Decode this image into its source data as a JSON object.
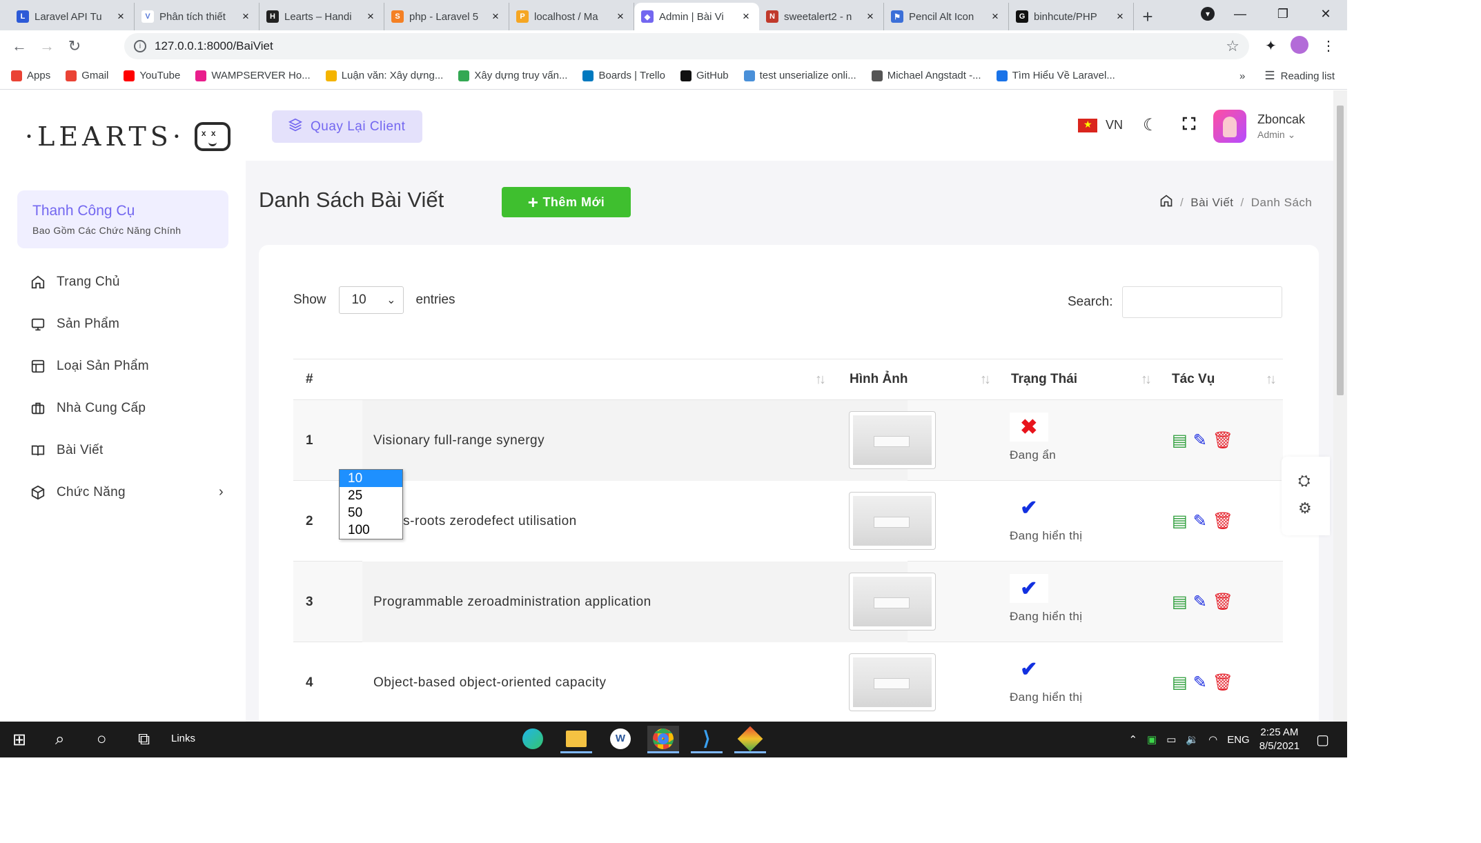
{
  "browser": {
    "tabs": [
      {
        "title": "Laravel API Tu",
        "color": "#2d5ad7",
        "glyph": "L"
      },
      {
        "title": "Phân tích thiết",
        "color": "#ffffff",
        "glyph": "V"
      },
      {
        "title": "Learts – Handi",
        "color": "#222222",
        "glyph": "H"
      },
      {
        "title": "php - Laravel 5",
        "color": "#f48024",
        "glyph": "S"
      },
      {
        "title": "localhost / Ma",
        "color": "#f5a623",
        "glyph": "P"
      },
      {
        "title": "Admin | Bài Vi",
        "color": "#7367f0",
        "glyph": "◆"
      },
      {
        "title": "sweetalert2 - n",
        "color": "#c0392b",
        "glyph": "N"
      },
      {
        "title": "Pencil Alt Icon",
        "color": "#3b6fd8",
        "glyph": "⚑"
      },
      {
        "title": "binhcute/PHP",
        "color": "#111111",
        "glyph": "G"
      }
    ],
    "active_tab_index": 5,
    "url": "127.0.0.1:8000/BaiViet",
    "bookmarks": [
      {
        "label": "Apps",
        "color": "#ea4335"
      },
      {
        "label": "Gmail",
        "color": "#ea4335"
      },
      {
        "label": "YouTube",
        "color": "#ff0000"
      },
      {
        "label": "WAMPSERVER Ho...",
        "color": "#e91e8c"
      },
      {
        "label": "Luận văn: Xây dựng...",
        "color": "#f4b400"
      },
      {
        "label": "Xây dựng truy vấn...",
        "color": "#34a853"
      },
      {
        "label": "Boards | Trello",
        "color": "#0079bf"
      },
      {
        "label": "GitHub",
        "color": "#111111"
      },
      {
        "label": "test unserialize onli...",
        "color": "#4a90d9"
      },
      {
        "label": "Michael Angstadt -...",
        "color": "#555555"
      },
      {
        "label": "Tìm Hiểu Về Laravel...",
        "color": "#1a73e8"
      }
    ],
    "bookmarks_more": "»",
    "reading_list": "Reading list"
  },
  "sidebar": {
    "logo_text": "·LEARTS·",
    "toolbox_title": "Thanh Công Cụ",
    "toolbox_subtitle": "Bao Gồm Các Chức Năng Chính",
    "items": [
      {
        "label": "Trang Chủ",
        "icon": "home-icon"
      },
      {
        "label": "Sản Phẩm",
        "icon": "monitor-icon"
      },
      {
        "label": "Loại Sản Phẩm",
        "icon": "layout-icon"
      },
      {
        "label": "Nhà Cung Cấp",
        "icon": "briefcase-icon"
      },
      {
        "label": "Bài Viết",
        "icon": "book-icon"
      },
      {
        "label": "Chức Năng",
        "icon": "box-icon"
      }
    ]
  },
  "header": {
    "back_label": "Quay Lại Client",
    "lang": "VN",
    "user_name": "Zboncak",
    "user_role": "Admin"
  },
  "page": {
    "title": "Danh Sách Bài Viết",
    "add_label": "Thêm Mới",
    "breadcrumb": [
      "Bài Viết",
      "Danh Sách"
    ]
  },
  "table_controls": {
    "show_label": "Show",
    "entries_label": "entries",
    "selected": "10",
    "options": [
      "10",
      "25",
      "50",
      "100"
    ],
    "search_label": "Search:"
  },
  "table": {
    "columns": [
      "#",
      "Hình Ảnh",
      "Trạng Thái",
      "Tác Vụ"
    ],
    "rows": [
      {
        "id": "1",
        "title": "Visionary full-range synergy",
        "status": "Đang ẩn",
        "visible": false
      },
      {
        "id": "2",
        "title": "Grass-roots zerodefect utilisation",
        "status": "Đang hiển thị",
        "visible": true
      },
      {
        "id": "3",
        "title": "Programmable zeroadministration application",
        "status": "Đang hiển thị",
        "visible": true
      },
      {
        "id": "4",
        "title": "Object-based object-oriented capacity",
        "status": "Đang hiển thị",
        "visible": true
      }
    ]
  },
  "taskbar": {
    "links_label": "Links",
    "lang": "ENG",
    "time": "2:25 AM",
    "date": "8/5/2021"
  }
}
